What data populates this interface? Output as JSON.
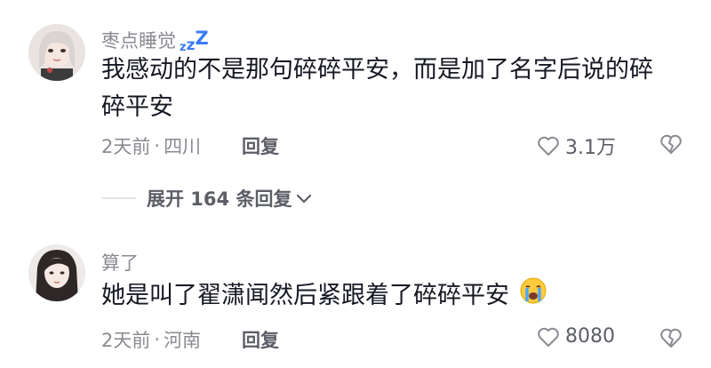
{
  "comments": [
    {
      "username": "枣点睡觉",
      "username_badge": "zzZ",
      "text_line1": "我感动的不是那句碎碎平安，而是加了名字后说的碎",
      "text_line2": "碎平安",
      "time": "2天前",
      "location": "四川",
      "reply_label": "回复",
      "likes": "3.1万"
    },
    {
      "username": "算了",
      "text_line1": "她是叫了翟潇闻然后紧跟着了碎碎平安",
      "emoji": "crying-face",
      "time": "2天前",
      "location": "河南",
      "reply_label": "回复",
      "likes": "8080"
    }
  ],
  "expand": {
    "label": "展开 164 条回复"
  },
  "colors": {
    "accent_blue": "#3a7bf5",
    "meta_gray": "#8a8b91",
    "text_dark": "#161823"
  }
}
